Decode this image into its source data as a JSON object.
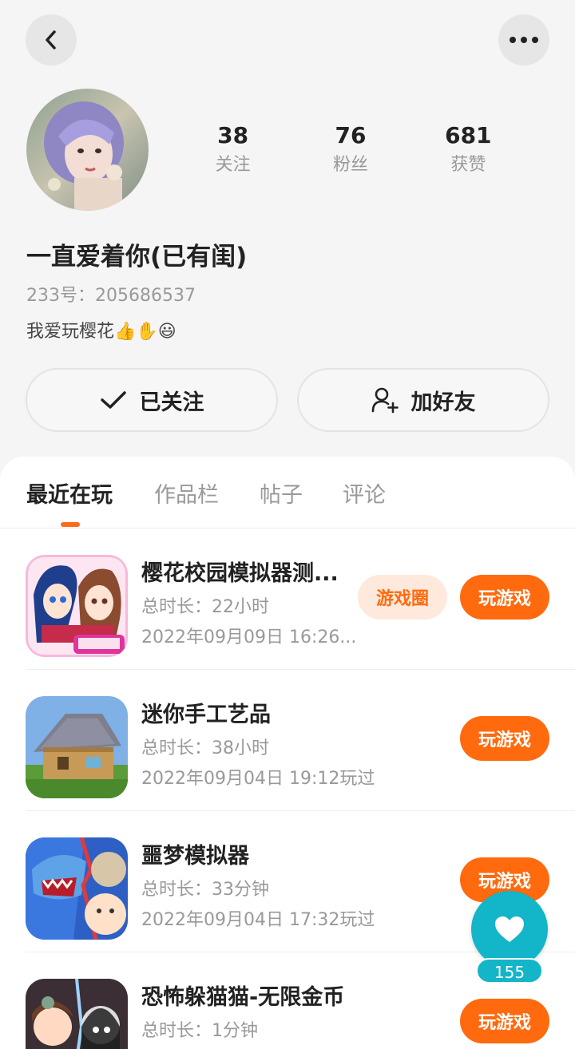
{
  "header": {
    "back_icon": "chevron-left-icon",
    "more_icon": "more-horizontal-icon"
  },
  "profile": {
    "name": "一直爱着你(已有闺)",
    "uid_label": "233号：",
    "uid": "205686537",
    "bio": "我爱玩樱花👍✋😃",
    "stats": [
      {
        "value": "38",
        "label": "关注"
      },
      {
        "value": "76",
        "label": "粉丝"
      },
      {
        "value": "681",
        "label": "获赞"
      }
    ]
  },
  "actions": {
    "followed_label": "已关注",
    "add_friend_label": "加好友"
  },
  "tabs": [
    {
      "label": "最近在玩",
      "active": true
    },
    {
      "label": "作品栏",
      "active": false
    },
    {
      "label": "帖子",
      "active": false
    },
    {
      "label": "评论",
      "active": false
    }
  ],
  "games": [
    {
      "title": "樱花校园模拟器测...",
      "duration_label": "总时长：",
      "duration": "22小时",
      "last_played": "2022年09月09日 16:26...",
      "circle_label": "游戏圈",
      "play_label": "玩游戏"
    },
    {
      "title": "迷你手工艺品",
      "duration_label": "总时长：",
      "duration": "38小时",
      "last_played": "2022年09月04日 19:12玩过",
      "play_label": "玩游戏"
    },
    {
      "title": "噩梦模拟器",
      "duration_label": "总时长：",
      "duration": "33分钟",
      "last_played": "2022年09月04日 17:32玩过",
      "play_label": "玩游戏"
    },
    {
      "title": "恐怖躲猫猫-无限金币",
      "duration_label": "总时长：",
      "duration": "1分钟",
      "last_played": "",
      "play_label": "玩游戏"
    }
  ],
  "floating_like": {
    "count": "155",
    "icon": "heart-icon"
  },
  "colors": {
    "accent": "#ff6a0e",
    "like_button": "#13b5c8"
  }
}
